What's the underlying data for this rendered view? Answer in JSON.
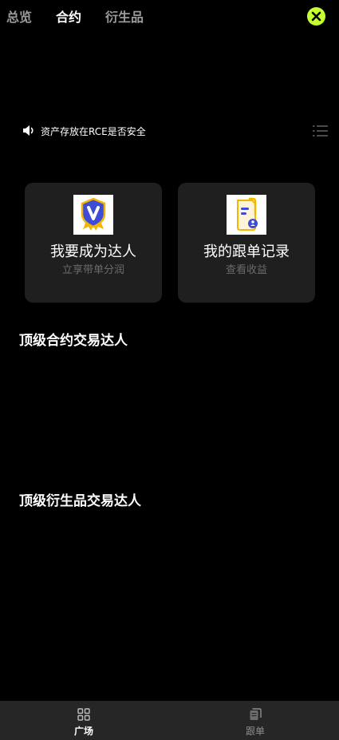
{
  "tabs": [
    {
      "label": "总览",
      "active": false
    },
    {
      "label": "合约",
      "active": true
    },
    {
      "label": "衍生品",
      "active": false
    }
  ],
  "close_icon": "close-icon",
  "accent_color": "#c6ff2e",
  "notice": {
    "icon": "speaker-icon",
    "text": "资产存放在RCE是否安全",
    "list_icon": "list-icon"
  },
  "cards": [
    {
      "title": "我要成为达人",
      "subtitle": "立享带单分润",
      "icon": "verified-badge-icon"
    },
    {
      "title": "我的跟单记录",
      "subtitle": "查看收益",
      "icon": "document-user-icon"
    }
  ],
  "sections": [
    {
      "title": "顶级合约交易达人"
    },
    {
      "title": "顶级衍生品交易达人"
    }
  ],
  "bottom_nav": [
    {
      "label": "广场",
      "icon": "grid-icon",
      "active": true
    },
    {
      "label": "跟单",
      "icon": "copy-icon",
      "active": false
    }
  ]
}
